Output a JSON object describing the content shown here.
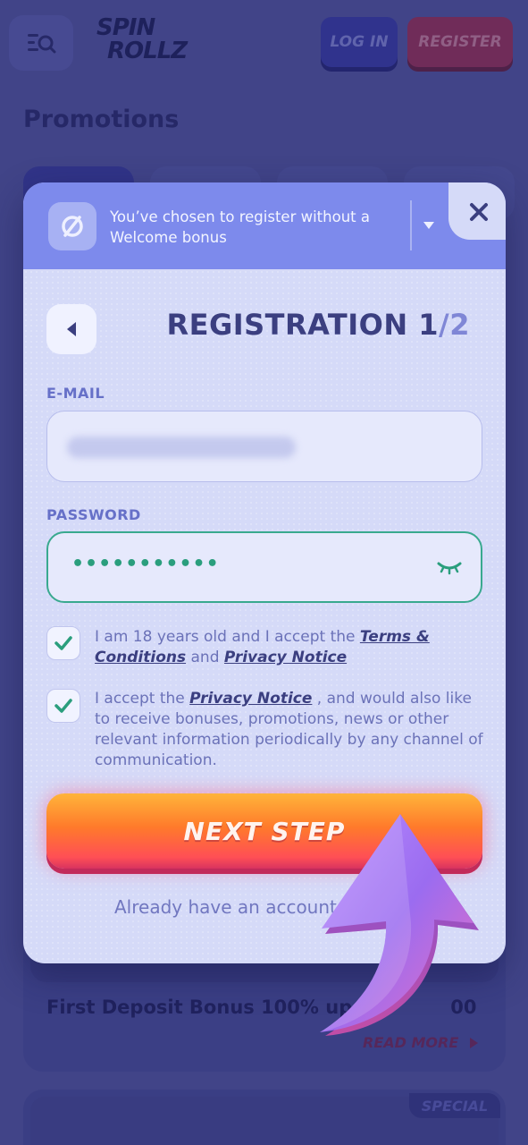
{
  "header": {
    "logo_line1": "SPIN",
    "logo_line2": "ROLLZ",
    "login_label": "LOG IN",
    "register_label": "REGISTER"
  },
  "page": {
    "title": "Promotions",
    "card_title": "First Deposit Bonus 100% up",
    "card_title_tail": "00",
    "read_more_label": "READ MORE",
    "special_badge": "SPECIAL"
  },
  "modal": {
    "bonus_notice": "You’ve chosen to register without a Welcome bonus",
    "title_main": "REGISTRATION 1",
    "title_sep": "/",
    "title_total": "2",
    "email_label": "E-MAIL",
    "password_label": "PASSWORD",
    "password_value": "•••••••••••",
    "terms": {
      "text_before": "I am 18 years old and I accept the ",
      "terms_link": "Terms & Conditions",
      "text_and": " and ",
      "privacy_link": "Privacy Notice"
    },
    "marketing": {
      "text_before": "I accept the ",
      "privacy_link": "Privacy Notice",
      "text_after": " , and would also like to receive bonuses, promotions, news or other relevant information periodically by any channel of communication."
    },
    "next_label": "NEXT STEP",
    "account_text": "Already have an account"
  },
  "colors": {
    "accent_green": "#39a98f",
    "title_navy": "#3b3f80",
    "bonus_bar": "#7d8aec",
    "button_orange": "#ff7a2b",
    "button_pink": "#ff4f55"
  },
  "icons": {
    "menu": "search-menu-icon",
    "bonus": "no-bonus-icon",
    "dropdown": "caret-down-icon",
    "close": "close-icon",
    "back": "caret-left-icon",
    "password_toggle": "eye-closed-icon",
    "checkbox": "check-icon",
    "overlay": "curved-arrow-icon"
  }
}
